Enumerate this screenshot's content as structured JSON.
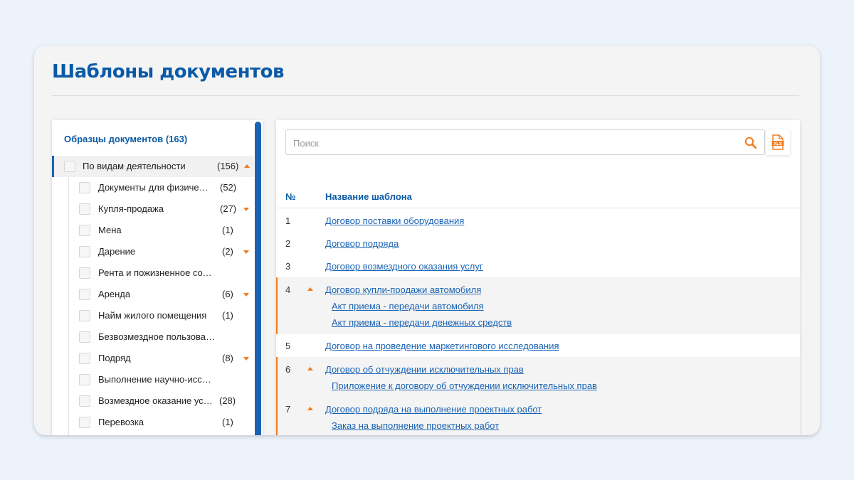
{
  "page": {
    "title": "Шаблоны документов"
  },
  "sidebar": {
    "heading": "Образцы документов (163)",
    "parent": {
      "label": "По видам деятельности",
      "count": "(156)"
    },
    "items": [
      {
        "label": "Документы для физических лиц",
        "count": "(52)",
        "expandable": false
      },
      {
        "label": "Купля-продажа",
        "count": "(27)",
        "expandable": true
      },
      {
        "label": "Мена",
        "count": "(1)",
        "expandable": false
      },
      {
        "label": "Дарение",
        "count": "(2)",
        "expandable": true
      },
      {
        "label": "Рента и пожизненное содержание с иждивением",
        "count": "",
        "expandable": false
      },
      {
        "label": "Аренда",
        "count": "(6)",
        "expandable": true
      },
      {
        "label": "Найм жилого помещения",
        "count": "(1)",
        "expandable": false
      },
      {
        "label": "Безвозмездное пользование",
        "count": "",
        "expandable": false
      },
      {
        "label": "Подряд",
        "count": "(8)",
        "expandable": true
      },
      {
        "label": "Выполнение научно-исследовательских работ",
        "count": "",
        "expandable": false
      },
      {
        "label": "Возмездное оказание услуг",
        "count": "(28)",
        "expandable": false
      },
      {
        "label": "Перевозка",
        "count": "(1)",
        "expandable": false
      }
    ]
  },
  "search": {
    "placeholder": "Поиск",
    "value": ""
  },
  "export": {
    "icon": "xls-icon",
    "label": "XLS"
  },
  "table": {
    "headers": {
      "number": "№",
      "name": "Название шаблона"
    },
    "rows": [
      {
        "num": "1",
        "name": "Договор поставки оборудования",
        "expanded": false,
        "children": []
      },
      {
        "num": "2",
        "name": "Договор подряда",
        "expanded": false,
        "children": []
      },
      {
        "num": "3",
        "name": "Договор возмездного оказания услуг",
        "expanded": false,
        "children": []
      },
      {
        "num": "4",
        "name": "Договор купли-продажи автомобиля",
        "expanded": true,
        "children": [
          "Акт приема - передачи автомобиля",
          "Акт приема - передачи денежных средств"
        ]
      },
      {
        "num": "5",
        "name": "Договор на проведение маркетингового исследования",
        "expanded": false,
        "children": []
      },
      {
        "num": "6",
        "name": "Договор об отчуждении исключительных прав",
        "expanded": true,
        "children": [
          "Приложение к договору об отчуждении исключительных прав"
        ]
      },
      {
        "num": "7",
        "name": "Договор подряда на выполнение проектных работ",
        "expanded": true,
        "children": [
          "Заказ на выполнение проектных работ"
        ]
      }
    ]
  },
  "colors": {
    "brand_blue": "#0b5aa6",
    "accent_orange": "#f07b1e",
    "background": "#edf3fb"
  }
}
